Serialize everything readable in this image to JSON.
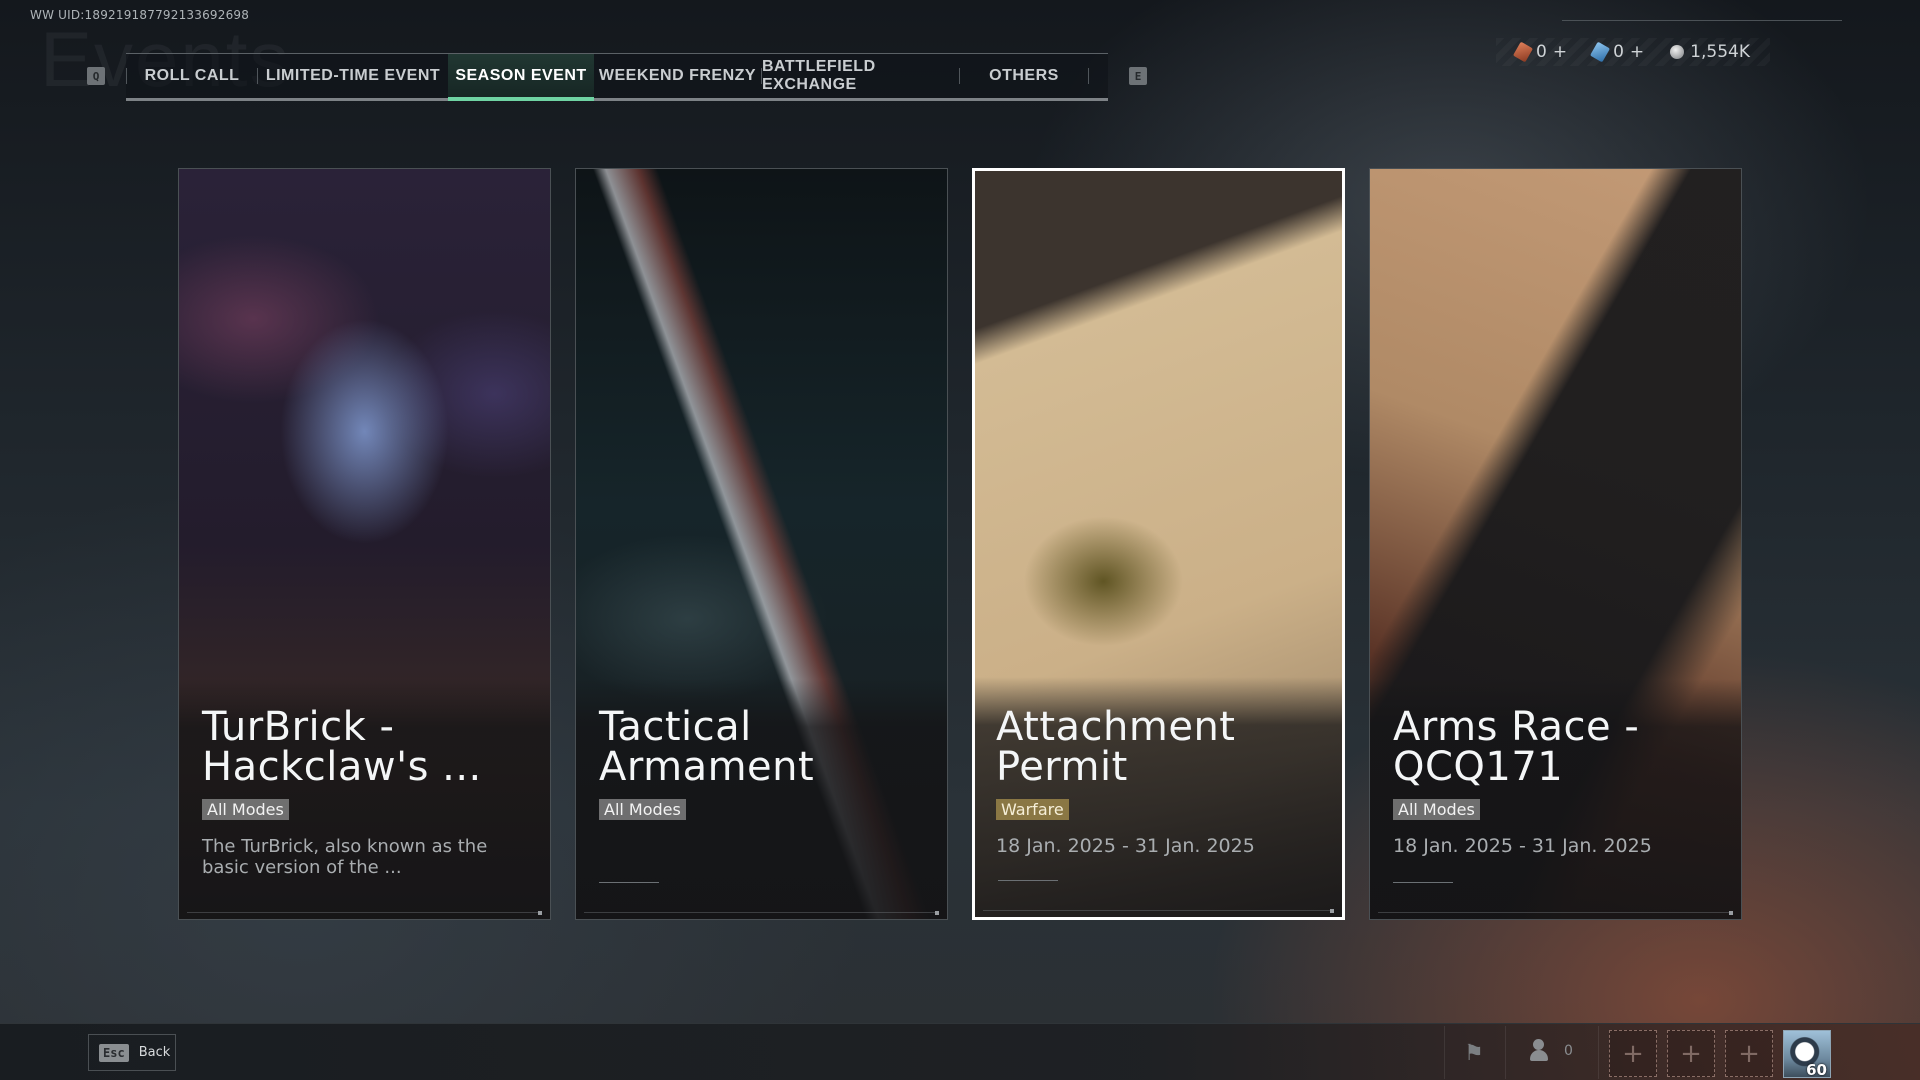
{
  "uid": "WW UID:1892191877921336926​98",
  "page_title_ghost": "Events",
  "tabs": {
    "prev_key": "Q",
    "next_key": "E",
    "items": [
      {
        "label": "ROLL CALL",
        "active": false
      },
      {
        "label": "LIMITED-TIME EVENT",
        "active": false
      },
      {
        "label": "SEASON EVENT",
        "active": true
      },
      {
        "label": "WEEKEND FRENZY",
        "active": false
      },
      {
        "label": "BATTLEFIELD EXCHANGE",
        "active": false
      },
      {
        "label": "OTHERS",
        "active": false
      }
    ]
  },
  "currencies": [
    {
      "icon": "red-ticket-icon",
      "value": "0",
      "action": "+"
    },
    {
      "icon": "blue-ticket-icon",
      "value": "0",
      "action": "+"
    },
    {
      "icon": "coin-icon",
      "value": "1,554K"
    }
  ],
  "cards": [
    {
      "title": "TurBrick -\nHackclaw's ...",
      "tag": "All Modes",
      "tag_style": "default",
      "subtitle": "The TurBrick, also known as the basic version of the ...",
      "subtitle_type": "description",
      "selected": false
    },
    {
      "title": "Tactical\nArmament",
      "tag": "All Modes",
      "tag_style": "default",
      "subtitle": "",
      "subtitle_type": "none",
      "selected": false
    },
    {
      "title": "Attachment\nPermit",
      "tag": "Warfare",
      "tag_style": "warfare",
      "subtitle": "18 Jan. 2025 - 31 Jan. 2025",
      "subtitle_type": "date",
      "selected": true
    },
    {
      "title": "Arms Race -\nQCQ171",
      "tag": "All Modes",
      "tag_style": "default",
      "subtitle": "18 Jan. 2025 - 31 Jan. 2025",
      "subtitle_type": "date",
      "selected": false
    }
  ],
  "bottom_bar": {
    "back_key": "Esc",
    "back_label": "Back",
    "party_count": "0",
    "slot_label": "+",
    "player_level": "60"
  },
  "colors": {
    "tab_active_accent": "#6fd3a3",
    "warfare_tag": "#8a7744",
    "default_tag": "#8c8c8c"
  }
}
